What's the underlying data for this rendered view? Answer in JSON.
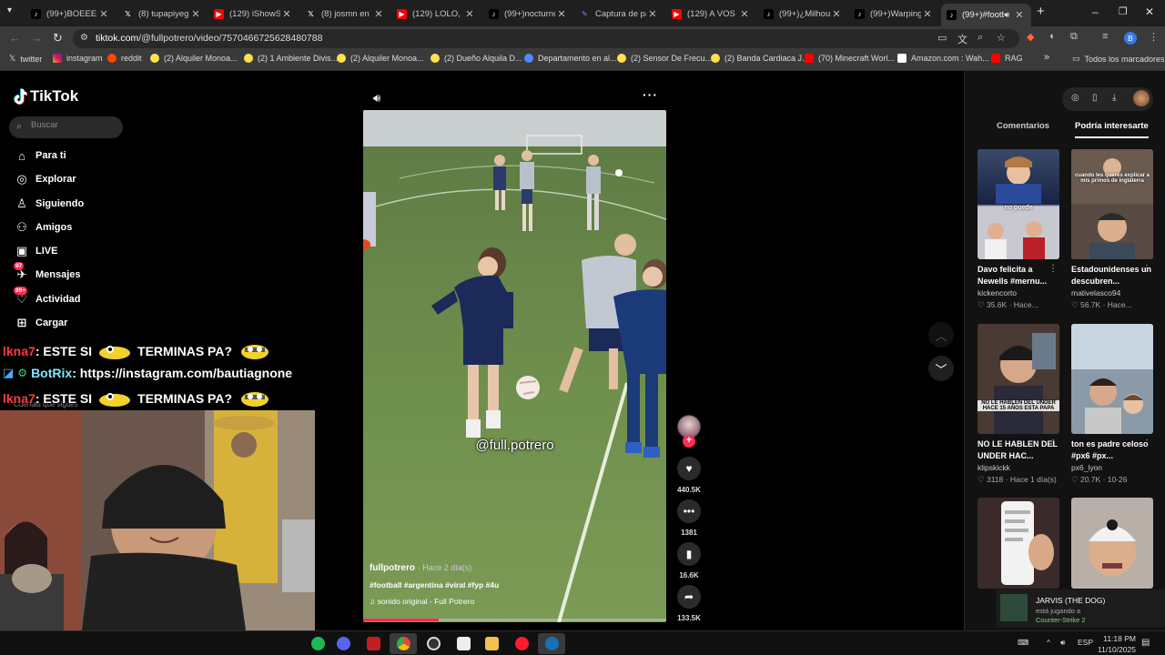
{
  "browser": {
    "tabs": [
      {
        "label": "(99+)BOEEE #",
        "icon": "tiktok-icon"
      },
      {
        "label": "(8) tupapiyego",
        "icon": "x-icon"
      },
      {
        "label": "(129) iShowSp",
        "icon": "youtube-icon"
      },
      {
        "label": "(8) josmn en X",
        "icon": "x-icon"
      },
      {
        "label": "(129) LOLO, BA",
        "icon": "youtube-icon"
      },
      {
        "label": "(99+)nocturno",
        "icon": "tiktok-icon"
      },
      {
        "label": "Captura de pa",
        "icon": "capture-icon"
      },
      {
        "label": "(129) A VOS PA",
        "icon": "youtube-icon"
      },
      {
        "label": "(99+)¿Milhous",
        "icon": "tiktok-icon"
      },
      {
        "label": "(99+)Warping",
        "icon": "tiktok-icon"
      },
      {
        "label": "(99+)#footb",
        "icon": "tiktok-icon",
        "active": true
      }
    ],
    "url_host": "tiktok.com",
    "url_path": "/@fullpotrero/video/7570466725628480788",
    "profile_initial": "B",
    "bookmarks": [
      "twitter",
      "instagram",
      "reddit",
      "(2) Alquiler Monoa...",
      "(2) 1 Ambiente Divis...",
      "(2) Alquiler Monoa...",
      "(2) Dueño Alquila D...",
      "Departamento en al...",
      "(2) Sensor De Frecu...",
      "(2) Banda Cardiaca J...",
      "(70) Minecraft Worl...",
      "Amazon.com : Wah...",
      "RAG"
    ],
    "bookmarks_all": "Todos los marcadores"
  },
  "tiktok": {
    "logo": "TikTok",
    "search_placeholder": "Buscar",
    "nav": [
      {
        "label": "Para ti",
        "icon": "home-icon"
      },
      {
        "label": "Explorar",
        "icon": "compass-icon"
      },
      {
        "label": "Siguiendo",
        "icon": "following-icon"
      },
      {
        "label": "Amigos",
        "icon": "friends-icon"
      },
      {
        "label": "LIVE",
        "icon": "live-icon"
      },
      {
        "label": "Mensajes",
        "icon": "messages-icon",
        "badge": "97"
      },
      {
        "label": "Actividad",
        "icon": "activity-icon",
        "badge": "99+"
      },
      {
        "label": "Cargar",
        "icon": "upload-icon"
      }
    ],
    "following_accounts": "Cuentas que sigues",
    "video": {
      "watermark": "@full.potrero",
      "author": "fullpotrero",
      "posted": "· Hace 2 día(s)",
      "tags": "#football #argentina #viral #fyp #4u",
      "sound": "sonido original - Full Potrero",
      "progress": 0.25
    },
    "actions": {
      "likes": "440.5K",
      "comments": "1381",
      "saves": "16.6K",
      "shares": "133.5K"
    },
    "right_tabs": [
      "Comentarios",
      "Podría interesarte"
    ],
    "suggested": [
      {
        "title": "Davo felicita a Newells #mernu...",
        "user": "kickencorto",
        "likes": "35.6K",
        "time": "Hace...",
        "caption": "no puede"
      },
      {
        "title": "Estadounidenses un descubren...",
        "user": "mativelasco94",
        "likes": "56.7K",
        "time": "Hace...",
        "caption": "cuando les queres explicar a mis primos de inglaterra"
      },
      {
        "title": "NO LE HABLEN DEL UNDER HAC...",
        "user": "klipskickk",
        "likes": "3118",
        "time": "Hace 1 día(s)",
        "caption": "NO LE HABLEN DEL UNDER HACE 15 AÑOS ESTA PAPA"
      },
      {
        "title": "ton es padre celoso #px6 #px...",
        "user": "px6_lyon",
        "likes": "20.7K",
        "time": "10-26",
        "caption": ""
      }
    ]
  },
  "stream": {
    "chat": [
      {
        "user": "lkna7",
        "text": ": ESTE SI",
        "text2": "TERMINAS PA?"
      },
      {
        "user": "BotRix",
        "text": ": https://instagram.com/bautiagnone",
        "text2": ""
      },
      {
        "user": "lkna7",
        "text": ": ESTE SI",
        "text2": "TERMINAS PA?"
      }
    ]
  },
  "notification": {
    "title": "JARVIS (THE DOG)",
    "status": "está jugando a",
    "game": "Counter-Strike 2"
  },
  "taskbar": {
    "lang": "ESP",
    "time": "11:18 PM",
    "date": "11/10/2025"
  }
}
